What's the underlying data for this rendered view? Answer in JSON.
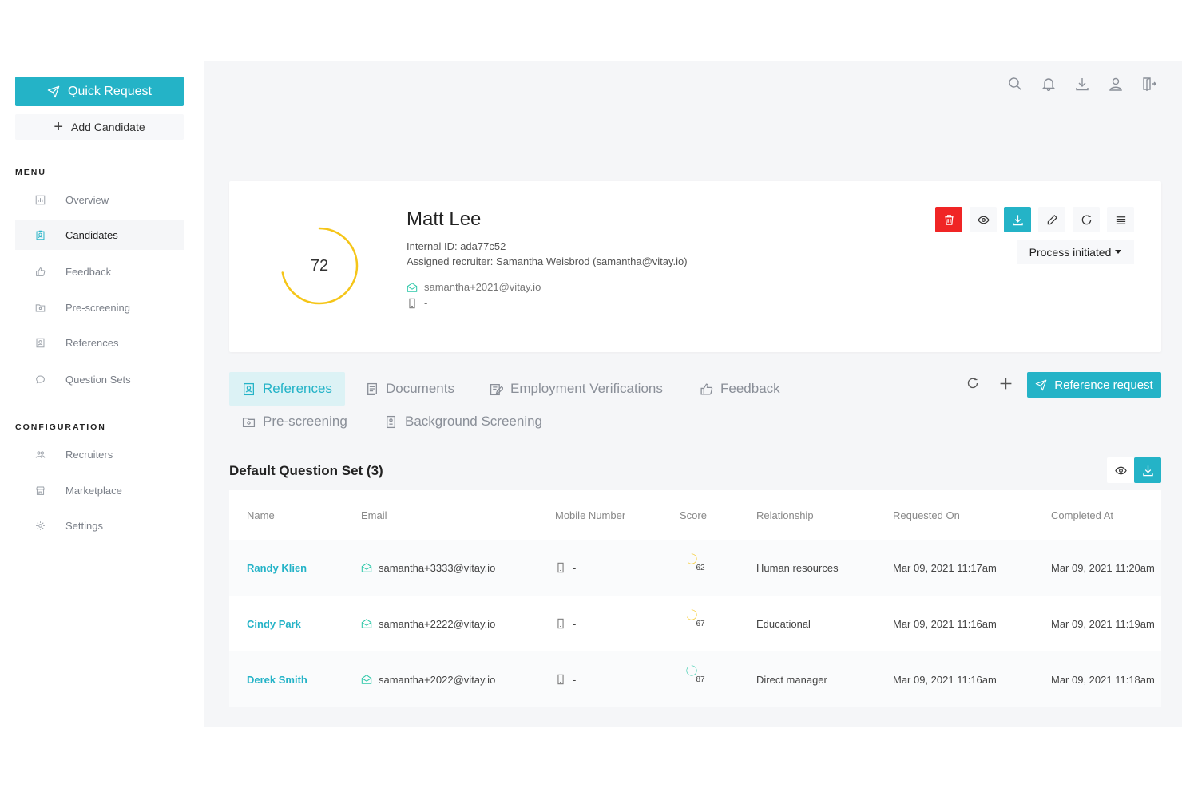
{
  "sidebar": {
    "quick_request_label": "Quick Request",
    "add_candidate_label": "Add Candidate",
    "menu_label": "MENU",
    "menu_items": [
      {
        "label": "Overview",
        "icon": "chart-icon"
      },
      {
        "label": "Candidates",
        "icon": "candidate-icon",
        "active": true
      },
      {
        "label": "Feedback",
        "icon": "thumbs-up-icon"
      },
      {
        "label": "Pre-screening",
        "icon": "folder-icon"
      },
      {
        "label": "References",
        "icon": "contact-card-icon"
      },
      {
        "label": "Question Sets",
        "icon": "chat-bubble-icon"
      }
    ],
    "config_label": "CONFIGURATION",
    "config_items": [
      {
        "label": "Recruiters",
        "icon": "users-icon"
      },
      {
        "label": "Marketplace",
        "icon": "store-icon"
      },
      {
        "label": "Settings",
        "icon": "gear-icon"
      }
    ]
  },
  "topbar": {
    "icons": [
      "search-icon",
      "bell-icon",
      "download-icon",
      "user-icon",
      "logout-icon"
    ]
  },
  "candidate": {
    "name": "Matt Lee",
    "score": "72",
    "score_fraction": 0.72,
    "internal_id": "Internal ID: ada77c52",
    "recruiter": "Assigned recruiter: Samantha Weisbrod (samantha@vitay.io)",
    "email": "samantha+2021@vitay.io",
    "mobile": "-",
    "status": "Process initiated"
  },
  "colors": {
    "accent": "#24b3c7",
    "delete": "#f02525",
    "score_yellow": "#f5c518",
    "score_green": "#2cc7a8"
  },
  "tabs": [
    {
      "label": "References",
      "icon": "contact-card-icon",
      "active": true
    },
    {
      "label": "Documents",
      "icon": "documents-icon"
    },
    {
      "label": "Employment Verifications",
      "icon": "edit-doc-icon"
    },
    {
      "label": "Feedback",
      "icon": "thumbs-up-icon"
    },
    {
      "label": "Pre-screening",
      "icon": "folder-icon"
    },
    {
      "label": "Background Screening",
      "icon": "badge-icon"
    }
  ],
  "reference_request_label": "Reference request",
  "question_set": {
    "title": "Default Question Set (3)",
    "columns": [
      "Name",
      "Email",
      "Mobile Number",
      "Score",
      "Relationship",
      "Requested On",
      "Completed At"
    ],
    "rows": [
      {
        "name": "Randy Klien",
        "email": "samantha+3333@vitay.io",
        "mobile": "-",
        "score": "62",
        "score_fraction": 0.62,
        "relationship": "Human resources",
        "requested": "Mar 09, 2021 11:17am",
        "completed": "Mar 09, 2021 11:20am"
      },
      {
        "name": "Cindy Park",
        "email": "samantha+2222@vitay.io",
        "mobile": "-",
        "score": "67",
        "score_fraction": 0.67,
        "relationship": "Educational",
        "requested": "Mar 09, 2021 11:16am",
        "completed": "Mar 09, 2021 11:19am"
      },
      {
        "name": "Derek Smith",
        "email": "samantha+2022@vitay.io",
        "mobile": "-",
        "score": "87",
        "score_fraction": 0.87,
        "relationship": "Direct manager",
        "requested": "Mar 09, 2021 11:16am",
        "completed": "Mar 09, 2021 11:18am"
      }
    ]
  }
}
